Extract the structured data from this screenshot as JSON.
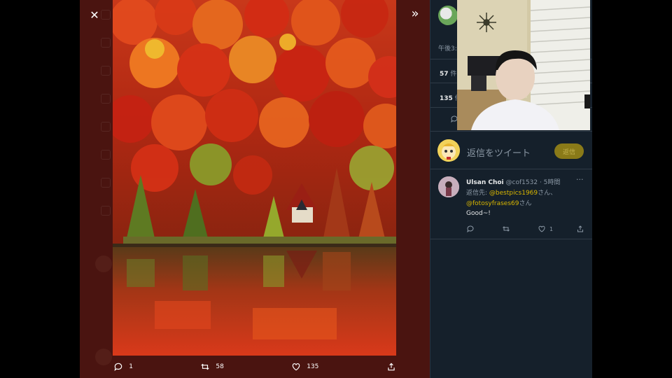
{
  "media_viewer": {
    "actions": [
      {
        "name": "reply",
        "count": "1"
      },
      {
        "name": "retweet",
        "count": "58"
      },
      {
        "name": "like",
        "count": "135"
      },
      {
        "name": "share",
        "count": ""
      }
    ]
  },
  "tweet_detail": {
    "time_partial": "午後3:",
    "stats": [
      {
        "count": "57",
        "label": "件の"
      },
      {
        "count": "135",
        "label": "件"
      }
    ]
  },
  "composer": {
    "placeholder": "返信をツイート",
    "reply_button": "返信"
  },
  "reply": {
    "name": "Ulsan Choi",
    "handle": "@cof1532",
    "time": "· 5時間",
    "reply_to_prefix": "返信先: ",
    "mention1": "@bestpics1969",
    "mention1_suffix": "さん、",
    "mention2": "@fotosyfrases69",
    "mention2_suffix": "さん",
    "text": "Good~!",
    "like_count": "1"
  },
  "colors": {
    "panel_bg": "#15202b",
    "viewer_bg": "#4a1410",
    "accent": "#d8b600"
  }
}
